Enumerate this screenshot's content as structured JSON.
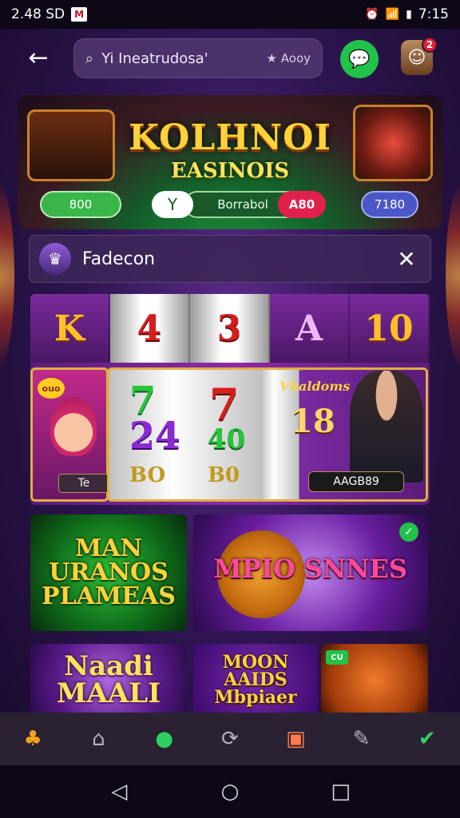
{
  "status_bar": {
    "time": "2.48 SD",
    "right_time": "7:15"
  },
  "header": {
    "search": {
      "text": "Yi Ineatrudosa'",
      "extra_label": "Aooy"
    }
  },
  "banner": {
    "title": "KOLHNOI",
    "subtitle": "EASINOIS",
    "pill_green": "800",
    "pill_white": "Y",
    "pill_dark": "Borrabol",
    "pill_red": "A80",
    "pill_blue": "7180"
  },
  "notification": {
    "badge": "2"
  },
  "popup": {
    "title": "Fadecon"
  },
  "slots": {
    "top_row": [
      "K",
      "4",
      "3",
      "A",
      "10"
    ],
    "left_badge": "ouo",
    "left_label": "Te",
    "reel_a_top": "7",
    "reel_a_bottom": "24",
    "reel_a_tiny": "BO",
    "reel_b_top": "7",
    "reel_b_bottom": "40",
    "reel_b_tiny": "B0",
    "reel_c_label": "Vhaldoms",
    "reel_c_num": "18",
    "reel_c_pill": "AAGB89"
  },
  "tiles": [
    {
      "text": "MAN URANOS PLAMEAS"
    },
    {
      "text": "MPIO SNNES"
    },
    {
      "text": "Naadi MAALI"
    },
    {
      "text": "MOON AAIDS Mbpiaer"
    },
    {
      "badge": "CU"
    }
  ],
  "icons": {
    "back": "arrow-left-icon",
    "search": "search-icon",
    "chat": "chat-icon",
    "avatar": "avatar-icon",
    "close": "close-icon"
  },
  "colors": {
    "accent_green": "#22c14a",
    "gold": "#ffd23a",
    "bg_purple": "#2e1550"
  }
}
